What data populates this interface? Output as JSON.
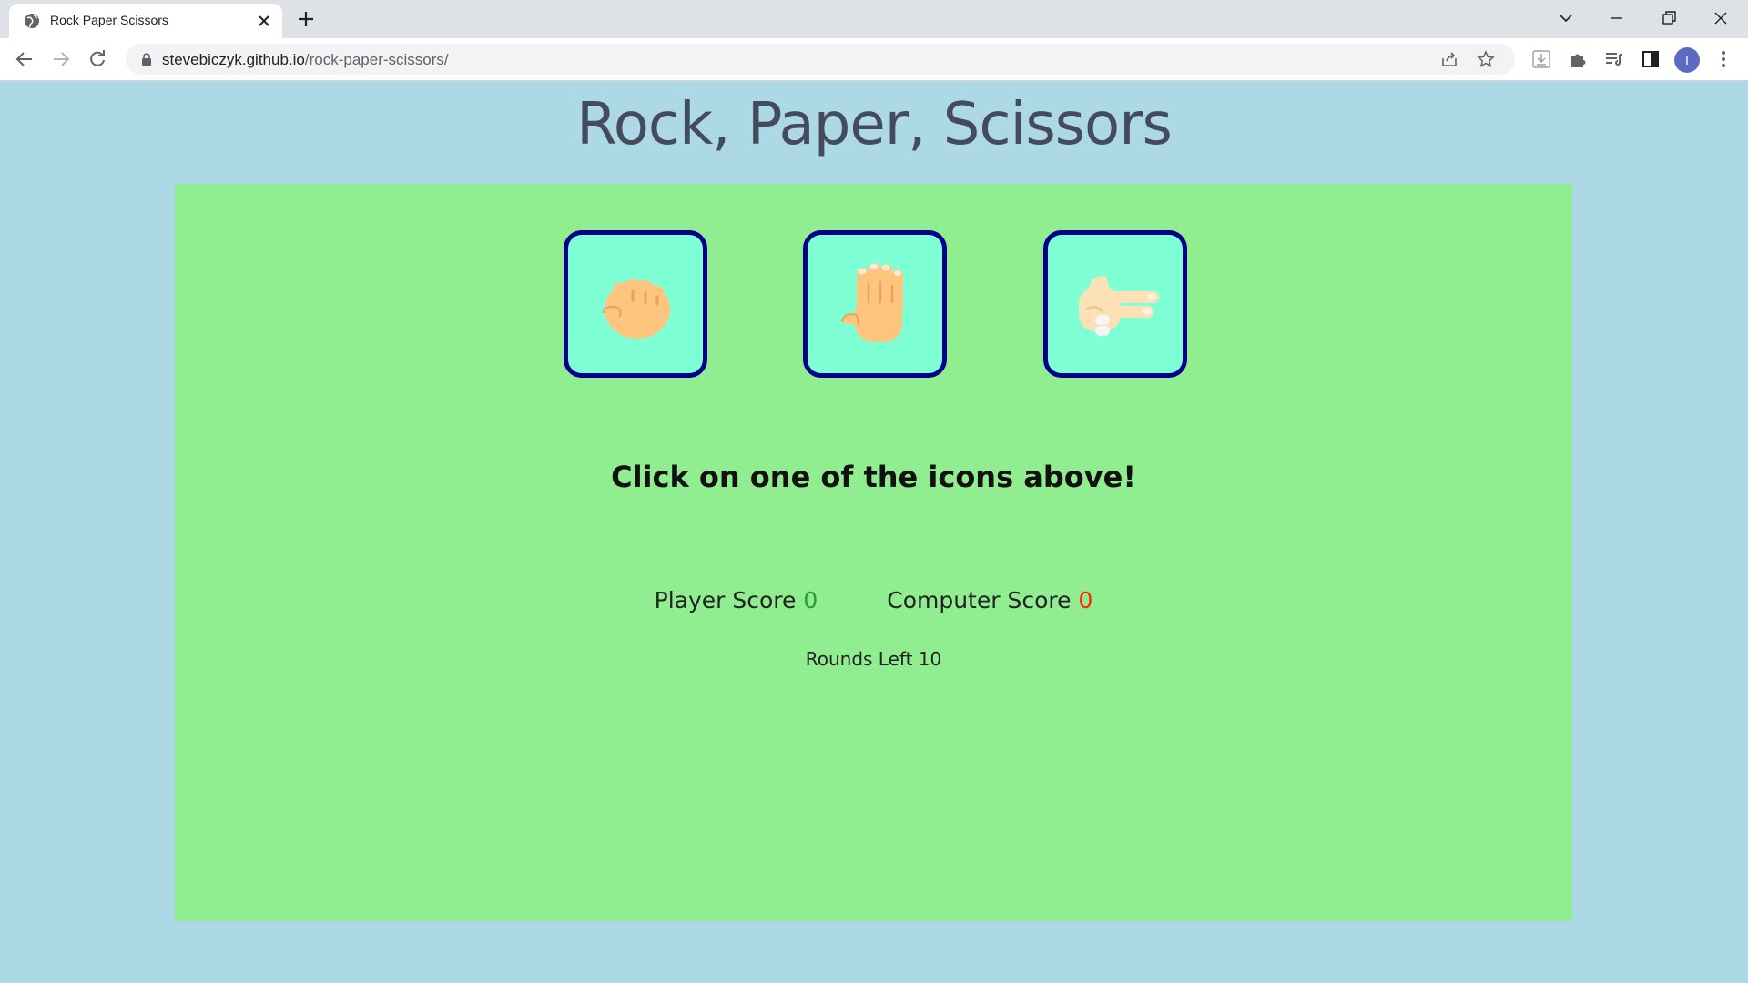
{
  "browser": {
    "tab_title": "Rock Paper Scissors",
    "url_domain": "stevebiczyk.github.io",
    "url_path": "/rock-paper-scissors/",
    "profile_initial": "I"
  },
  "page": {
    "title": "Rock, Paper, Scissors",
    "instruction": "Click on one of the icons above!",
    "player_score_label": "Player Score",
    "player_score": "0",
    "computer_score_label": "Computer Score",
    "computer_score": "0",
    "rounds_left_label": "Rounds Left",
    "rounds_left": "10"
  },
  "choices": [
    {
      "name": "rock",
      "icon": "rock-hand-icon"
    },
    {
      "name": "paper",
      "icon": "paper-hand-icon"
    },
    {
      "name": "scissors",
      "icon": "scissors-hand-icon"
    }
  ],
  "colors": {
    "page_background": "#add8e6",
    "panel_background": "#90ee90",
    "button_background": "#7fffd4",
    "button_border": "#00008b",
    "player_score": "#2e9b2e",
    "computer_score": "#ff2200"
  }
}
